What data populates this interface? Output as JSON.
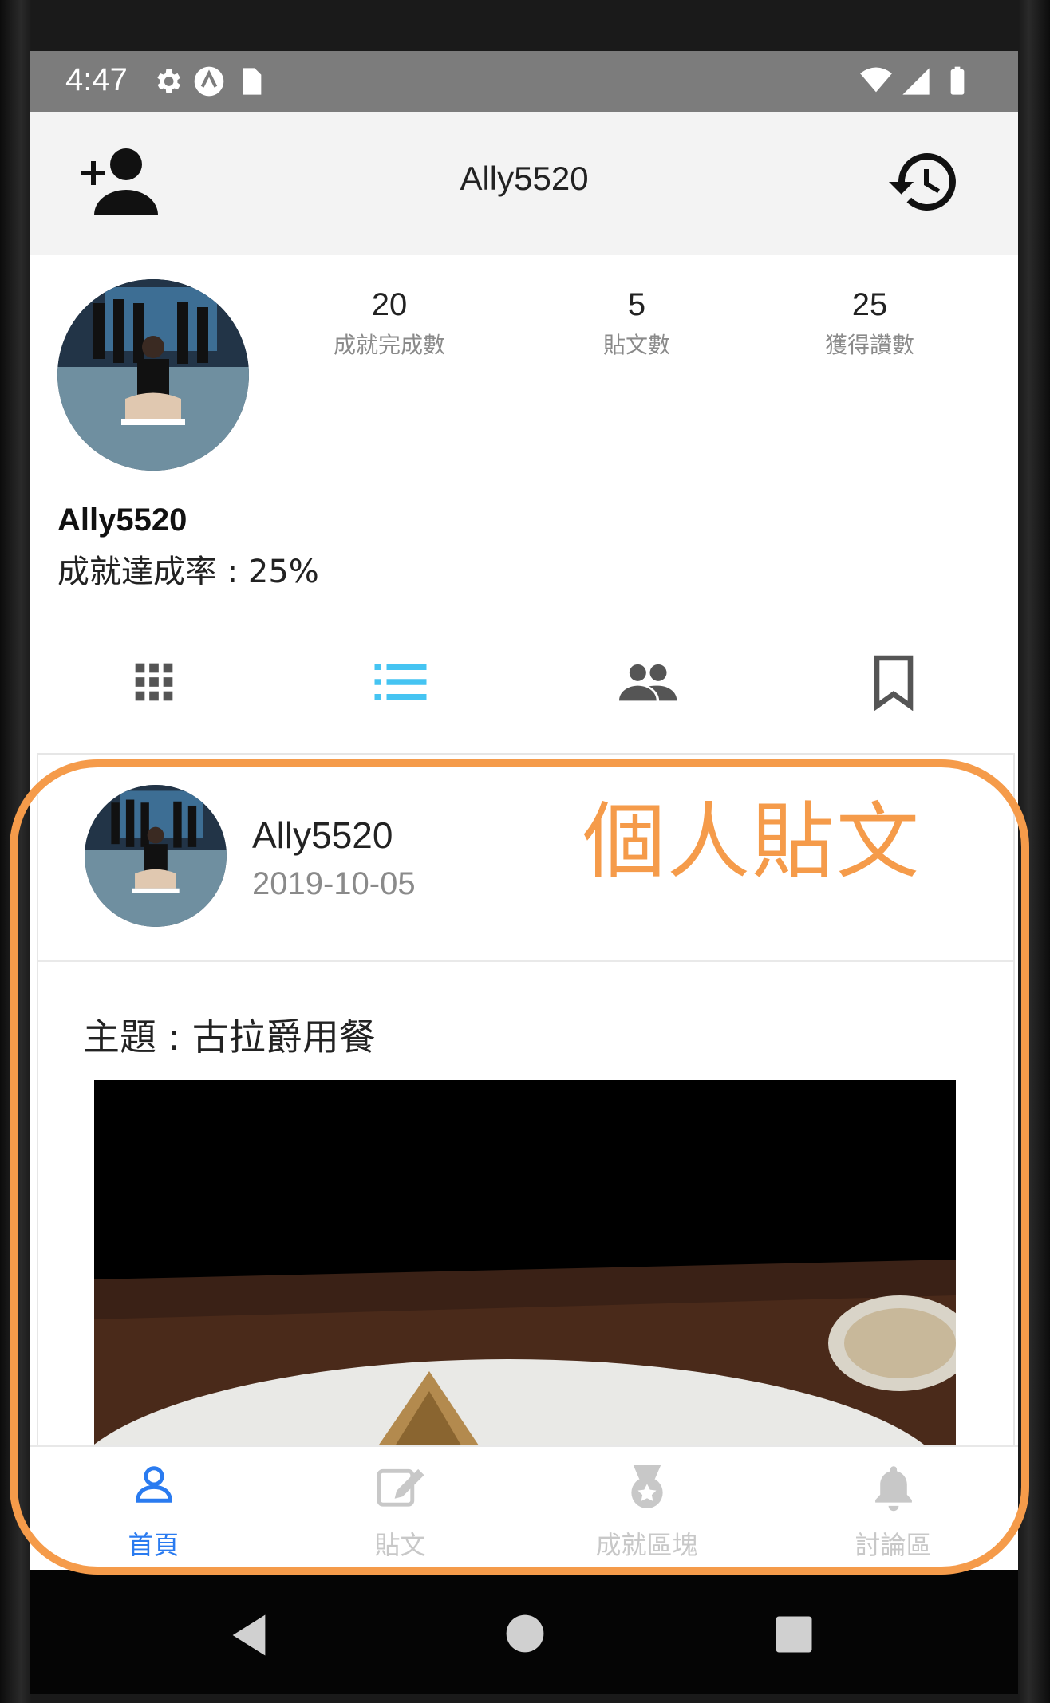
{
  "statusbar": {
    "time": "4:47"
  },
  "appbar": {
    "title": "Ally5520"
  },
  "profile": {
    "name": "Ally5520",
    "rate": "成就達成率 : 25%",
    "stats": [
      {
        "value": "20",
        "label": "成就完成數"
      },
      {
        "value": "5",
        "label": "貼文數"
      },
      {
        "value": "25",
        "label": "獲得讚數"
      }
    ]
  },
  "tabs": {
    "active_index": 1,
    "accent": "#45c4f2",
    "inactive": "#555555"
  },
  "post": {
    "author": "Ally5520",
    "date": "2019-10-05",
    "topic": "主題 : 古拉爵用餐"
  },
  "annotation": {
    "label": "個人貼文",
    "color": "#f59b4a"
  },
  "bottom_nav": {
    "items": [
      {
        "label": "首頁",
        "icon": "person-icon",
        "active": true
      },
      {
        "label": "貼文",
        "icon": "edit-icon",
        "active": false
      },
      {
        "label": "成就區塊",
        "icon": "medal-icon",
        "active": false
      },
      {
        "label": "討論區",
        "icon": "bell-icon",
        "active": false
      }
    ],
    "active_color": "#2a7bf0",
    "inactive_color": "#c8c8c8"
  }
}
